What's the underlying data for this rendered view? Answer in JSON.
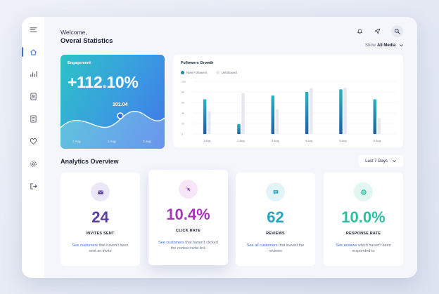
{
  "header": {
    "greeting": "Welcome,",
    "title": "Overal Statistics",
    "show_label": "Show",
    "show_value": "All Media"
  },
  "sidebar": {
    "items": [
      {
        "icon": "menu-icon"
      },
      {
        "icon": "home-icon",
        "active": true
      },
      {
        "icon": "bar-chart-icon"
      },
      {
        "icon": "contact-icon"
      },
      {
        "icon": "document-icon"
      },
      {
        "icon": "heart-icon"
      },
      {
        "icon": "settings-icon"
      },
      {
        "icon": "logout-icon"
      }
    ]
  },
  "top_actions": [
    {
      "icon": "bell-icon"
    },
    {
      "icon": "send-icon"
    },
    {
      "icon": "search-icon"
    }
  ],
  "engagement": {
    "label": "Engagement",
    "value": "+112.10%",
    "point_label": "101.04",
    "x_labels": [
      "1 Aug",
      "2 Aug",
      "3 Aug"
    ]
  },
  "chart_data": {
    "type": "bar",
    "title": "Followers Growth",
    "categories": [
      "1 Aug",
      "2 Aug",
      "3 Aug",
      "4 Aug",
      "5 Aug",
      "6 Aug"
    ],
    "y_ticks": [
      "0",
      "2k",
      "4k",
      "6k",
      "8k",
      "10k"
    ],
    "ylim": [
      0,
      10000
    ],
    "series": [
      {
        "name": "New Followers",
        "color": "#1f88b6",
        "values": [
          6600,
          1900,
          7300,
          8000,
          8500,
          6600
        ]
      },
      {
        "name": "Unfollowed",
        "color": "#e6e9f0",
        "values": [
          4300,
          7800,
          4700,
          8700,
          8800,
          3000
        ]
      }
    ],
    "legend": "top-left",
    "grid": true
  },
  "analytics": {
    "title": "Analytics Overview",
    "period": "Last 7 Days",
    "cards": [
      {
        "icon": "mail-icon",
        "value": "24",
        "label": "INVITES SENT",
        "link": "See customers",
        "desc": " that haven't been sent an invite",
        "color": "#5a3d9e",
        "icon_bg": "#ece7f6"
      },
      {
        "icon": "cursor-click-icon",
        "value": "10.4%",
        "label": "CLICK RATE",
        "link": "See customers",
        "desc": " that haven't clicked the review invite link",
        "color": "#a637b8",
        "icon_bg": "#f6e6f8"
      },
      {
        "icon": "chat-icon",
        "value": "62",
        "label": "REVIEWS",
        "link": "See all customers",
        "desc": " that leaved the reviews",
        "color": "#27a5c0",
        "icon_bg": "#e2f4f7"
      },
      {
        "icon": "target-icon",
        "value": "10.0%",
        "label": "RESPONSE RATE",
        "link": "See reviews",
        "desc": " which haven't been responded to",
        "color": "#2bbfa0",
        "icon_bg": "#e1f6f1"
      }
    ]
  }
}
